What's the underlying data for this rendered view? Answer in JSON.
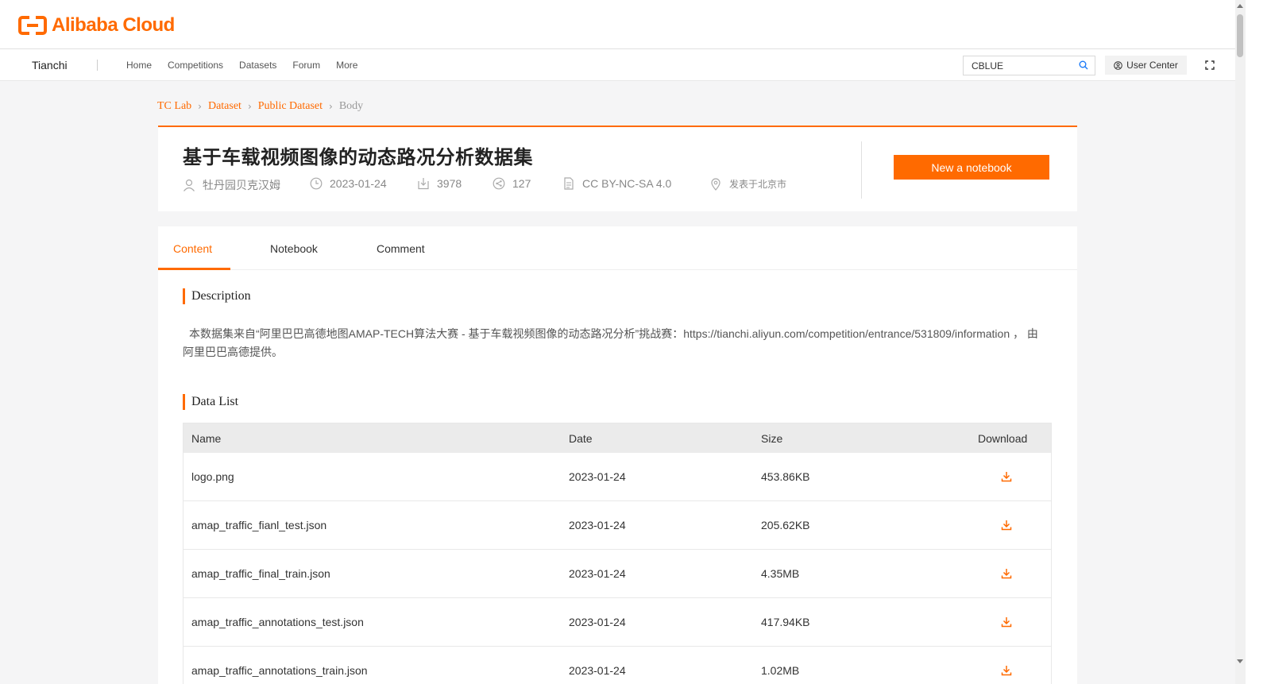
{
  "brand": {
    "logo_text": "Alibaba Cloud",
    "accent_color": "#ff6a00"
  },
  "nav": {
    "brand": "Tianchi",
    "links": [
      "Home",
      "Competitions",
      "Datasets",
      "Forum",
      "More"
    ],
    "search_value": "CBLUE",
    "user_center": "User Center"
  },
  "breadcrumb": [
    "TC Lab",
    "Dataset",
    "Public Dataset",
    "Body"
  ],
  "header": {
    "title": "基于车载视频图像的动态路况分析数据集",
    "author": "牡丹园贝克汉姆",
    "date": "2023-01-24",
    "downloads": "3978",
    "shares": "127",
    "license": "CC BY-NC-SA 4.0",
    "location": "发表于北京市",
    "new_notebook": "New a notebook"
  },
  "tabs": [
    "Content",
    "Notebook",
    "Comment"
  ],
  "description": {
    "heading": "Description",
    "text": "本数据集来自“阿里巴巴高德地图AMAP-TECH算法大赛 - 基于车载视频图像的动态路况分析”挑战赛：https://tianchi.aliyun.com/competition/entrance/531809/information ， 由阿里巴巴高德提供。"
  },
  "data_list": {
    "heading": "Data List",
    "columns": [
      "Name",
      "Date",
      "Size",
      "Download"
    ],
    "rows": [
      {
        "name": "logo.png",
        "date": "2023-01-24",
        "size": "453.86KB"
      },
      {
        "name": "amap_traffic_fianl_test.json",
        "date": "2023-01-24",
        "size": "205.62KB"
      },
      {
        "name": "amap_traffic_final_train.json",
        "date": "2023-01-24",
        "size": "4.35MB"
      },
      {
        "name": "amap_traffic_annotations_test.json",
        "date": "2023-01-24",
        "size": "417.94KB"
      },
      {
        "name": "amap_traffic_annotations_train.json",
        "date": "2023-01-24",
        "size": "1.02MB"
      }
    ]
  }
}
